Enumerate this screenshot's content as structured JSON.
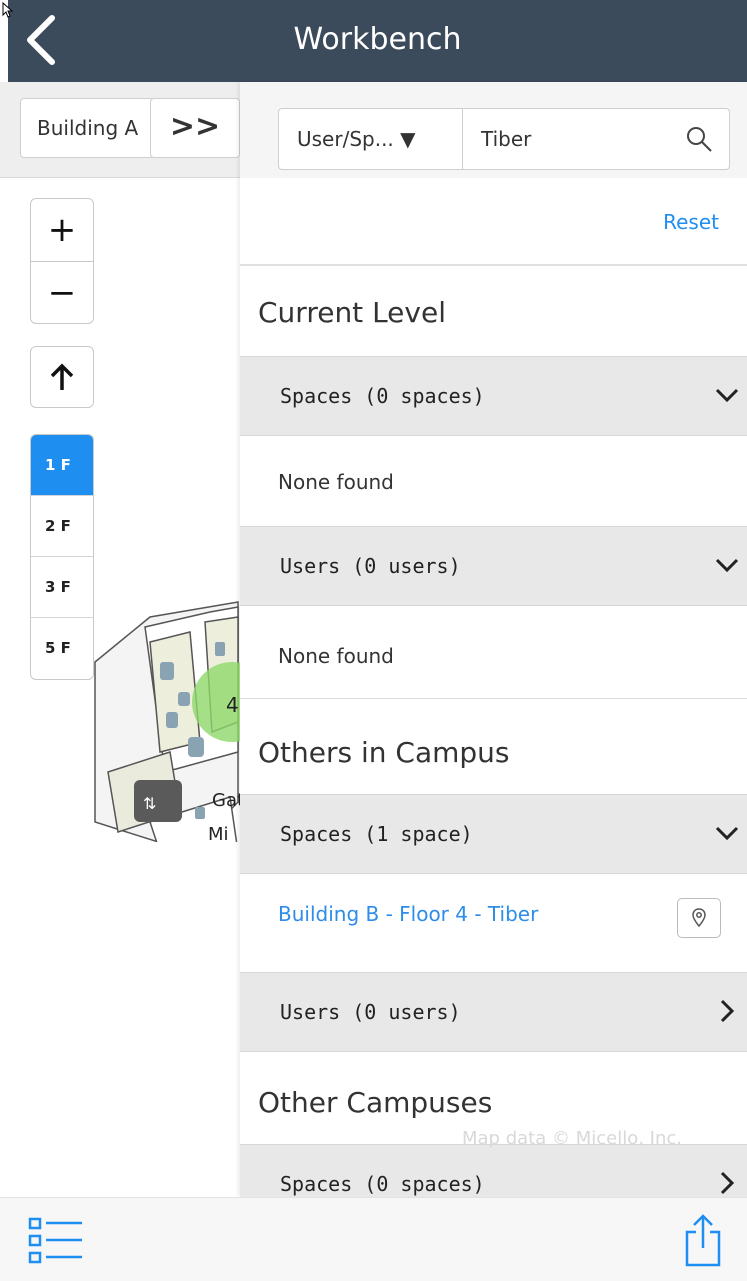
{
  "header": {
    "title": "Workbench"
  },
  "map": {
    "building_label": "Building A",
    "expand_label": ">>",
    "zoom_in": "+",
    "zoom_out": "−",
    "floors": [
      "1 F",
      "2 F",
      "3 F",
      "5 F"
    ],
    "active_floor": "1 F",
    "labels": {
      "cluster": "4",
      "area1": "Gateshead",
      "area2": "Mi"
    }
  },
  "search": {
    "type_label": "User/Sp... ▼",
    "query": "Tiber"
  },
  "panel": {
    "reset_label": "Reset",
    "current_level": {
      "title": "Current Level",
      "spaces_label": "Spaces (0 spaces)",
      "spaces_empty": "None found",
      "users_label": "Users (0 users)",
      "users_empty": "None found"
    },
    "others_in_campus": {
      "title": "Others in Campus",
      "spaces_label": "Spaces (1 space)",
      "result": "Building B - Floor 4 - Tiber",
      "users_label": "Users (0 users)"
    },
    "other_campuses": {
      "title": "Other Campuses",
      "spaces_label": "Spaces (0 spaces)"
    }
  },
  "footer": {
    "map_attribution": "Map data © Micello, Inc."
  },
  "colors": {
    "header": "#3c4b5b",
    "accent": "#1f8ef1",
    "link": "#2d8de8"
  },
  "icons": [
    "back-chevron-icon",
    "search-icon",
    "chevron-down-icon",
    "chevron-right-icon",
    "map-pin-icon",
    "list-icon",
    "share-icon",
    "arrow-up-icon",
    "elevator-icon"
  ]
}
